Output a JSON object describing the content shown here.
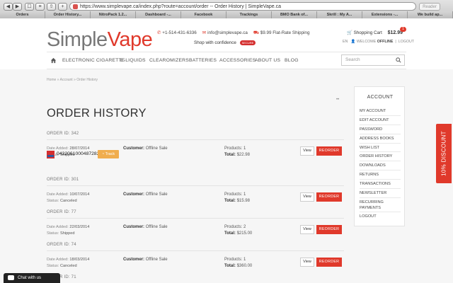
{
  "browser": {
    "url": "https://www.simplevape.ca/index.php?route=account/order -- Order History | SimpleVape.ca",
    "reader_label": "Reader",
    "tabs": [
      "Orders",
      "Order History...",
      "NitroPack 1.2...",
      "Dashboard -...",
      "Facebook",
      "Trackings",
      "BMO Bank of...",
      "Skrill : My A...",
      "Extensions -...",
      "We build ap..."
    ]
  },
  "header": {
    "logo_part1": "Simple",
    "logo_part2": "Vape",
    "phone": "+1-514-431-6336",
    "email": "info@simplevape.ca",
    "shipping": "$9.99 Flat-Rate Shipping",
    "shop_confidence": "Shop with confidence",
    "secure_badge": "SECURE",
    "cart_label": "Shopping Cart",
    "cart_total": "$12.99",
    "cart_count": "1",
    "lang": "EN",
    "welcome": "WELCOME",
    "user": "OFFLINE",
    "logout": "LOGOUT"
  },
  "nav": {
    "items": [
      "ELECTRONIC CIGARETTE",
      "E-LIQUIDS",
      "CLEAROMIZERS",
      "BATTERIES",
      "ACCESSORIES",
      "ABOUT US",
      "BLOG"
    ],
    "search_placeholder": "Search"
  },
  "page": {
    "breadcrumb": "Home » Account » Order History",
    "title": "ORDER HISTORY",
    "dots": "••"
  },
  "labels": {
    "date_added": "Date Added:",
    "status": "Status:",
    "customer": "Customer:",
    "products": "Products:",
    "total": "Total:",
    "view": "View",
    "reorder": "REORDER",
    "track": "Track"
  },
  "orders": [
    {
      "id": "ORDER ID: 342",
      "date": "28/07/2014",
      "status": "Shipped",
      "customer": "Offline Sale",
      "products": "1",
      "total": "$22.98",
      "tracking": "0422061000487282"
    },
    {
      "id": "ORDER ID: 301",
      "date": "10/07/2014",
      "status": "Canceled",
      "customer": "Offline Sale",
      "products": "1",
      "total": "$15.98"
    },
    {
      "id": "ORDER ID: 77",
      "date": "22/03/2014",
      "status": "Shipped",
      "customer": "Offline Sale",
      "products": "2",
      "total": "$215.00"
    },
    {
      "id": "ORDER ID: 74",
      "date": "18/03/2014",
      "status": "Canceled",
      "customer": "Offline Sale",
      "products": "1",
      "total": "$360.00"
    },
    {
      "id": "ORDER ID: 71"
    }
  ],
  "sidebar": {
    "title": "ACCOUNT",
    "items": [
      "MY ACCOUNT",
      "EDIT ACCOUNT",
      "PASSWORD",
      "ADDRESS BOOKS",
      "WISH LIST",
      "ORDER HISTORY",
      "DOWNLOADS",
      "RETURNS",
      "TRANSACTIONS",
      "NEWSLETTER",
      "RECURRING PAYMENTS",
      "LOGOUT"
    ]
  },
  "promo": {
    "discount": "10% DISCOUNT"
  },
  "chat": {
    "label": "Chat with us"
  },
  "colors": {
    "brand_red": "#e0392b",
    "track_orange": "#f0ad4e"
  }
}
